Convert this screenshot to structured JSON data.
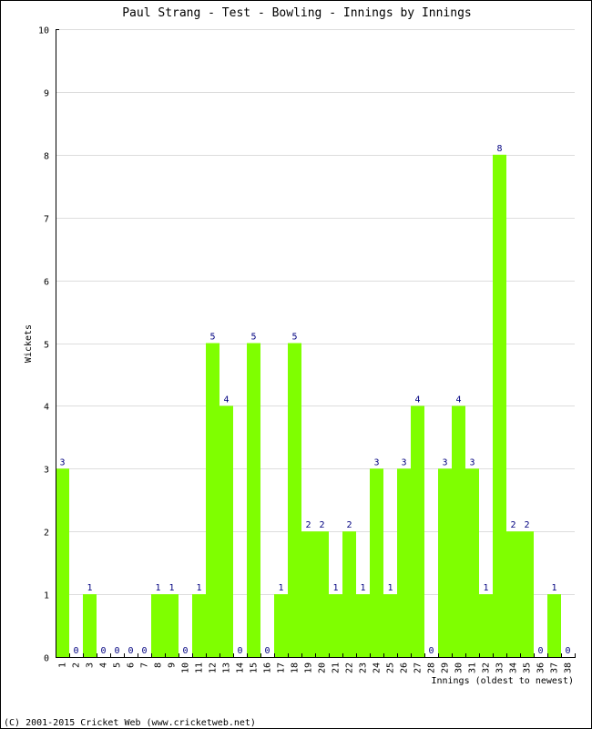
{
  "chart_data": {
    "type": "bar",
    "title": "Paul Strang - Test - Bowling - Innings by Innings",
    "xlabel": "Innings (oldest to newest)",
    "ylabel": "Wickets",
    "ylim": [
      0,
      10
    ],
    "yticks": [
      0,
      1,
      2,
      3,
      4,
      5,
      6,
      7,
      8,
      9,
      10
    ],
    "grid": true,
    "categories": [
      "1",
      "2",
      "3",
      "4",
      "5",
      "6",
      "7",
      "8",
      "9",
      "10",
      "11",
      "12",
      "13",
      "14",
      "15",
      "16",
      "17",
      "18",
      "19",
      "20",
      "21",
      "22",
      "23",
      "24",
      "25",
      "26",
      "27",
      "28",
      "29",
      "30",
      "31",
      "32",
      "33",
      "34",
      "35",
      "36",
      "37",
      "38"
    ],
    "values": [
      3,
      0,
      1,
      0,
      0,
      0,
      0,
      1,
      1,
      0,
      1,
      5,
      4,
      0,
      5,
      0,
      1,
      5,
      2,
      2,
      1,
      2,
      1,
      3,
      1,
      3,
      4,
      0,
      3,
      4,
      3,
      1,
      8,
      2,
      2,
      0,
      1,
      0
    ],
    "bar_color": "#7fff00",
    "label_color": "#000080"
  },
  "footer": "(C) 2001-2015 Cricket Web (www.cricketweb.net)"
}
